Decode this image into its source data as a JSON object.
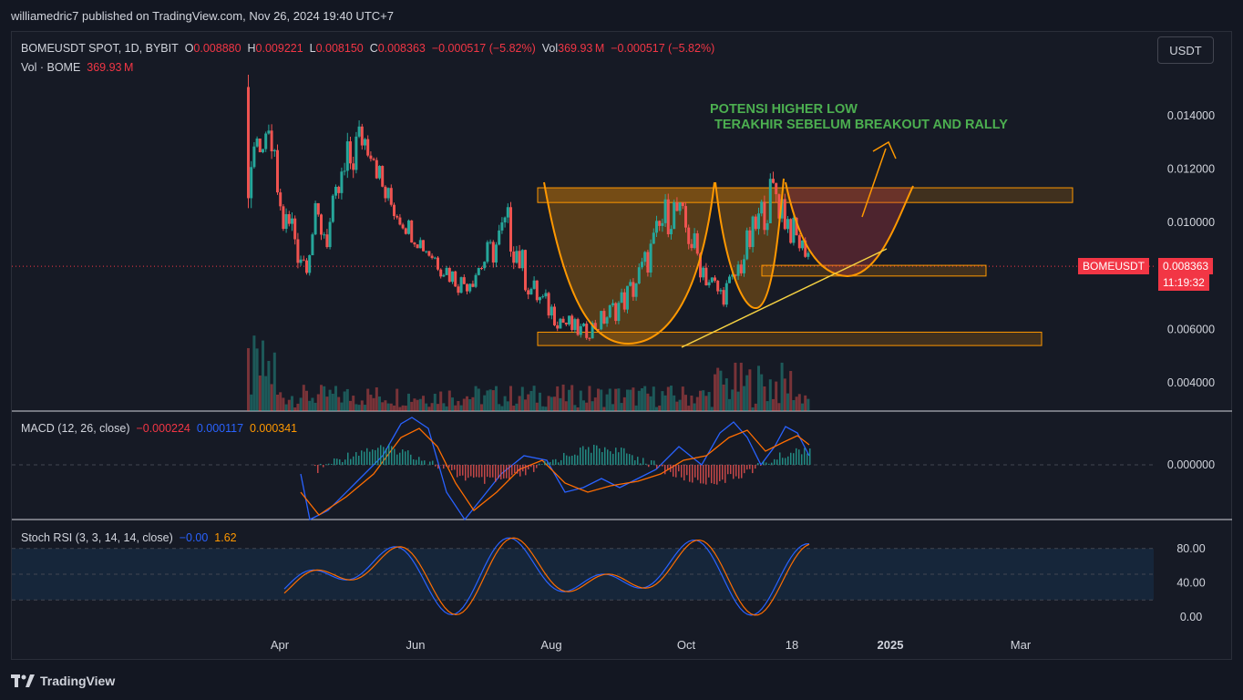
{
  "header": {
    "published": "williamedric7 published on TradingView.com, Nov 26, 2024 19:40 UTC+7"
  },
  "currency_button": "USDT",
  "legend": {
    "symbol": "BOMEUSDT SPOT, 1D, BYBIT",
    "o_label": "O",
    "o_value": "0.008880",
    "h_label": "H",
    "h_value": "0.009221",
    "l_label": "L",
    "l_value": "0.008150",
    "c_label": "C",
    "c_value": "0.008363",
    "change": "−0.000517 (−5.82%)",
    "vol_label": "Vol",
    "vol_value": "369.93 M",
    "vol_change": "−0.000517 (−5.82%)",
    "vol_series_label": "Vol · BOME",
    "vol_series_value": "369.93 M"
  },
  "macd_legend": {
    "label": "MACD (12, 26, close)",
    "hist": "−0.000224",
    "macd": "0.000117",
    "signal": "0.000341"
  },
  "stoch_legend": {
    "label": "Stoch RSI (3, 3, 14, 14, close)",
    "k": "−0.00",
    "d": "1.62"
  },
  "price_tags": {
    "symbol": "BOMEUSDT",
    "price": "0.008363",
    "countdown": "11:19:32"
  },
  "annotation": {
    "line1": "POTENSI HIGHER LOW",
    "line2": "TERAKHIR SEBELUM BREAKOUT AND RALLY"
  },
  "footer": {
    "brand": "TradingView"
  },
  "colors": {
    "up": "#26a69a",
    "down": "#ef5350",
    "accent": "#ff9800",
    "annotation": "#4caf50",
    "macd": "#2962ff",
    "signal": "#ff6d00"
  },
  "chart_data": {
    "type": "candlestick",
    "symbol": "BOMEUSDT",
    "timeframe": "1D",
    "price_axis": {
      "ticks": [
        "0.014000",
        "0.012000",
        "0.010000",
        "0.006000",
        "0.004000"
      ],
      "ylim": [
        0.0026,
        0.0165
      ]
    },
    "x_axis": {
      "ticks": [
        "Apr",
        "Jun",
        "Aug",
        "Oct",
        "18",
        "2025",
        "Mar"
      ]
    },
    "last": {
      "open": 0.00888,
      "high": 0.009221,
      "low": 0.00815,
      "close": 0.008363,
      "volume": "369.93M"
    },
    "price_path": [
      [
        0.01,
        0.0155
      ],
      [
        0.013,
        0.0125
      ],
      [
        0.012,
        0.014
      ],
      [
        0.0095,
        0.0105
      ],
      [
        0.0085,
        0.011
      ],
      [
        0.0078,
        0.0092
      ],
      [
        0.0095,
        0.0108
      ],
      [
        0.0088,
        0.0102
      ],
      [
        0.0104,
        0.0118
      ],
      [
        0.011,
        0.0135
      ],
      [
        0.0125,
        0.014
      ],
      [
        0.0122,
        0.0135
      ],
      [
        0.0105,
        0.0118
      ],
      [
        0.01,
        0.011
      ],
      [
        0.0095,
        0.0104
      ],
      [
        0.009,
        0.0098
      ],
      [
        0.0085,
        0.0094
      ],
      [
        0.008,
        0.009
      ],
      [
        0.0076,
        0.0085
      ],
      [
        0.0072,
        0.0082
      ],
      [
        0.0075,
        0.0086
      ],
      [
        0.008,
        0.0092
      ],
      [
        0.0084,
        0.0098
      ],
      [
        0.009,
        0.0108
      ],
      [
        0.008,
        0.0096
      ],
      [
        0.007,
        0.0082
      ],
      [
        0.0066,
        0.0076
      ],
      [
        0.0062,
        0.0072
      ],
      [
        0.0058,
        0.0068
      ],
      [
        0.0056,
        0.0064
      ],
      [
        0.0056,
        0.0062
      ],
      [
        0.0058,
        0.0066
      ],
      [
        0.0061,
        0.007
      ],
      [
        0.0064,
        0.0075
      ],
      [
        0.0068,
        0.008
      ],
      [
        0.0076,
        0.0088
      ],
      [
        0.0084,
        0.0098
      ],
      [
        0.0094,
        0.011
      ],
      [
        0.0098,
        0.0112
      ],
      [
        0.009,
        0.0104
      ],
      [
        0.008,
        0.0094
      ],
      [
        0.0072,
        0.0084
      ],
      [
        0.0068,
        0.0078
      ],
      [
        0.0072,
        0.0082
      ],
      [
        0.008,
        0.0094
      ],
      [
        0.009,
        0.0104
      ],
      [
        0.0098,
        0.0114
      ],
      [
        0.01,
        0.0124
      ],
      [
        0.0092,
        0.0108
      ],
      [
        0.0088,
        0.0096
      ],
      [
        0.0084,
        0.00922
      ]
    ],
    "zones": [
      {
        "name": "resistance",
        "y": [
          0.01075,
          0.0113
        ]
      },
      {
        "name": "higher-low",
        "y": [
          0.008,
          0.0084
        ]
      },
      {
        "name": "support",
        "y": [
          0.0054,
          0.0059
        ]
      }
    ],
    "current_price": 0.008363,
    "macd": {
      "params": "12, 26, close",
      "ticks": [
        "0.000000"
      ],
      "hist": -0.000224,
      "macd_value": 0.000117,
      "signal": 0.000341
    },
    "stoch_rsi": {
      "params": "3, 3, 14, 14, close",
      "ticks": [
        "80.00",
        "40.00",
        "0.00"
      ],
      "ylim": [
        0,
        100
      ],
      "k": -0.0,
      "d": 1.62
    }
  }
}
